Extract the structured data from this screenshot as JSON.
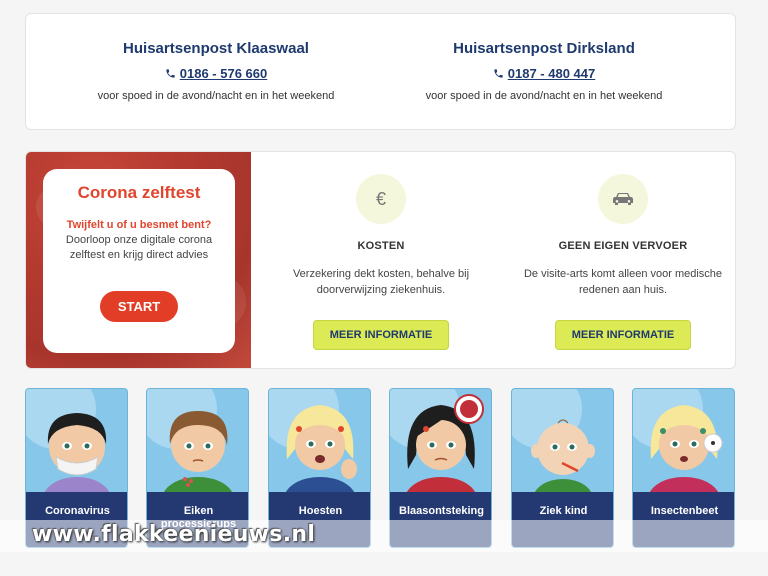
{
  "contacts": [
    {
      "name": "Huisartsenpost Klaaswaal",
      "phone": "0186 - 576 660",
      "note": "voor spoed in de avond/nacht en in het weekend"
    },
    {
      "name": "Huisartsenpost Dirksland",
      "phone": "0187 - 480 447",
      "note": "voor spoed in de avond/nacht en in het weekend"
    }
  ],
  "corona": {
    "title": "Corona zelftest",
    "question": "Twijfelt u of u besmet bent?",
    "text": " Doorloop onze digitale corona zelftest en krijg direct advies",
    "button": "START"
  },
  "info": [
    {
      "icon": "euro-icon",
      "symbol": "€",
      "title": "KOSTEN",
      "text": "Verzekering dekt kosten, behalve bij doorverwijzing ziekenhuis.",
      "button": "MEER INFORMATIE"
    },
    {
      "icon": "car-icon",
      "title": "GEEN EIGEN VERVOER",
      "text": "De visite-arts komt alleen voor medische redenen aan huis.",
      "button": "MEER INFORMATIE"
    }
  ],
  "symptoms": [
    {
      "label": "Coronavirus"
    },
    {
      "label": "Eiken processierups"
    },
    {
      "label": "Hoesten"
    },
    {
      "label": "Blaasontsteking"
    },
    {
      "label": "Ziek kind"
    },
    {
      "label": "Insectenbeet"
    }
  ],
  "watermark": "www.flakkeenieuws.nl",
  "colors": {
    "navy": "#1e3a6e",
    "accent": "#e0452e",
    "button": "#dcea55",
    "tile_label": "#243872"
  }
}
